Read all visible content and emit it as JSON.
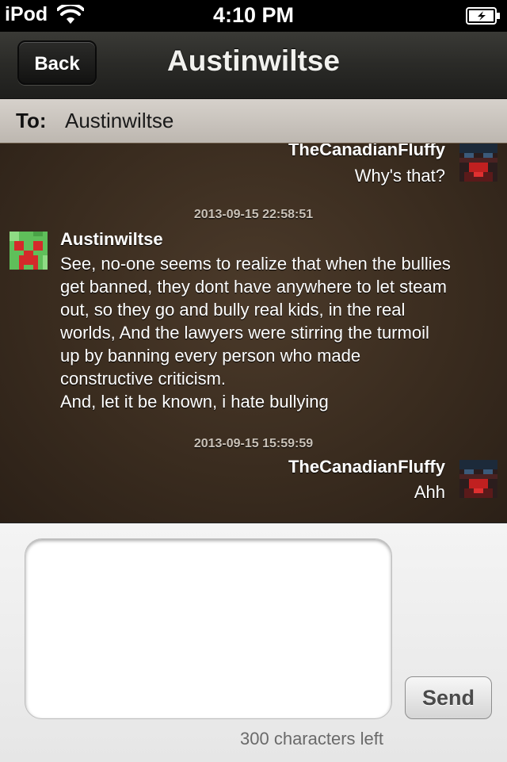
{
  "status_bar": {
    "carrier": "iPod",
    "time": "4:10 PM",
    "wifi_icon": "wifi-icon",
    "battery_icon": "battery-charging-icon"
  },
  "nav": {
    "back_label": "Back",
    "title": "Austinwiltse"
  },
  "to_bar": {
    "label": "To:",
    "value": "Austinwiltse"
  },
  "messages": [
    {
      "sender": "TheCanadianFluffy",
      "text": "Why's that?",
      "side": "right",
      "avatar": "user-avatar-icon"
    },
    {
      "timestamp": "2013-09-15 22:58:51",
      "sender": "Austinwiltse",
      "side": "left",
      "avatar": "creeper-avatar-icon",
      "lines": [
        "See, no-one seems to realize that when the bullies",
        "get banned, they dont have anywhere to let steam",
        "out, so they go and bully real kids, in the real",
        "worlds, And the lawyers were stirring the turmoil",
        "up by banning every person who made",
        "constructive criticism.",
        "And, let it be known, i hate bullying"
      ]
    },
    {
      "timestamp": "2013-09-15 15:59:59",
      "sender": "TheCanadianFluffy",
      "text": "Ahh",
      "side": "right",
      "avatar": "user-avatar-icon"
    }
  ],
  "compose": {
    "value": "",
    "send_label": "Send",
    "chars_left": "300 characters left"
  },
  "colors": {
    "chat_bg": "#3a2c1f",
    "accent": "#ffffff"
  }
}
